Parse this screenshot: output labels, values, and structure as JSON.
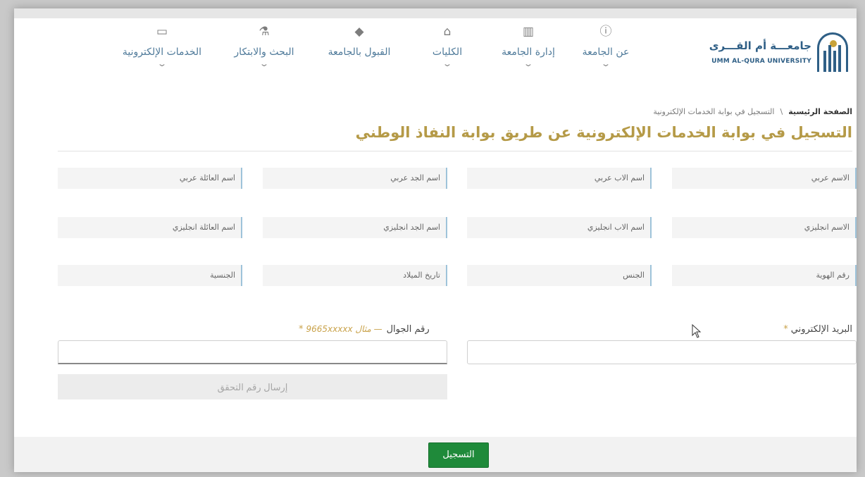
{
  "header": {
    "university_name_ar": "جامعـــة أم القـــرى",
    "university_name_en": "UMM AL-QURA UNIVERSITY",
    "nav": [
      {
        "label": "عن الجامعة",
        "icon": "info-circle-icon"
      },
      {
        "label": "إدارة الجامعة",
        "icon": "building-icon"
      },
      {
        "label": "الكليات",
        "icon": "institution-icon"
      },
      {
        "label": "القبول بالجامعة",
        "icon": "graduation-cap-icon"
      },
      {
        "label": "البحث والابتكار",
        "icon": "flask-icon"
      },
      {
        "label": "الخدمات الإلكترونية",
        "icon": "laptop-icon"
      }
    ]
  },
  "breadcrumb": {
    "home": "الصفحة الرئيسية",
    "separator": "\\",
    "current": "التسجيل في بوابة الخدمات الإلكترونية"
  },
  "page_title": "التسجيل في بوابة الخدمات الإلكترونية عن طريق بوابة النفاذ الوطني",
  "form": {
    "rows": [
      [
        "الاسم عربي",
        "اسم الاب عربي",
        "اسم الجد عربي",
        "اسم العائلة عربي"
      ],
      [
        "الاسم انجليزي",
        "اسم الاب انجليزي",
        "اسم الجد انجليزي",
        "اسم العائلة انجليزي"
      ],
      [
        "رقم الهوية",
        "الجنس",
        "تاريخ الميلاد",
        "الجنسية"
      ]
    ],
    "email_label": "البريد الإلكتروني",
    "mobile_label": "رقم الجوال",
    "mobile_hint": "— مثال 9665xxxxx",
    "required_mark": "*",
    "send_code_button": "إرسال رقم التحقق",
    "register_button": "التسجيل"
  },
  "colors": {
    "title_gold": "#b59a47",
    "nav_blue": "#4f7a9a",
    "register_green": "#1f8a3a"
  }
}
